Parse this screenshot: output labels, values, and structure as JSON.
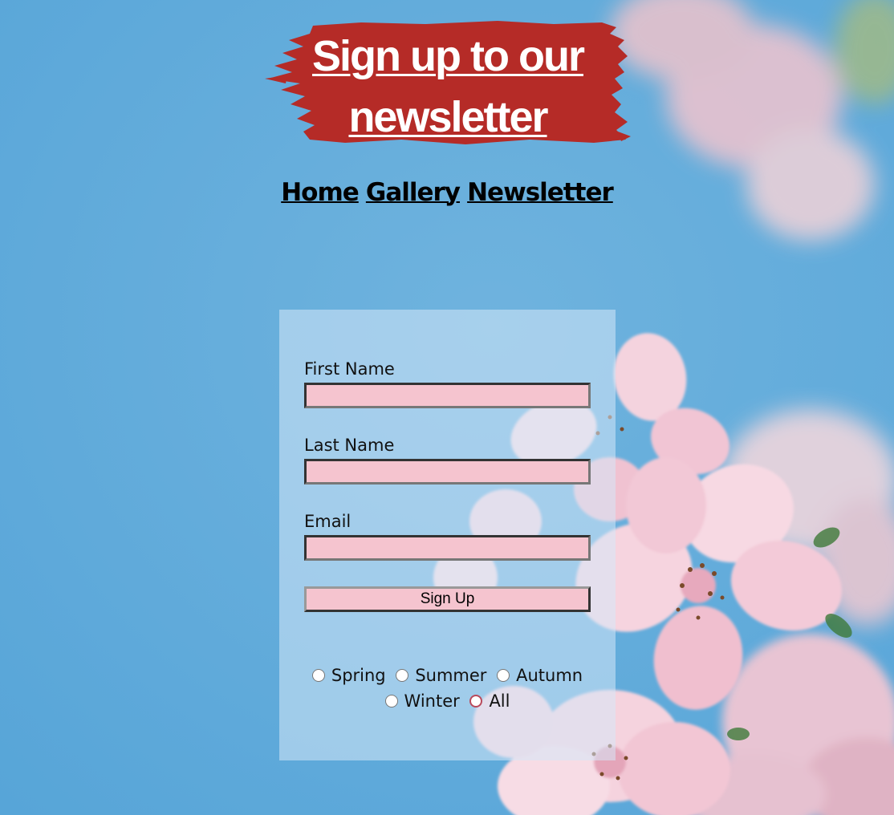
{
  "banner": {
    "title": "Sign up to our newsletter",
    "color": "#b52b27"
  },
  "nav": {
    "links": [
      "Home",
      "Gallery",
      "Newsletter"
    ]
  },
  "form": {
    "first_name_label": "First Name",
    "first_name_value": "",
    "last_name_label": "Last Name",
    "last_name_value": "",
    "email_label": "Email",
    "email_value": "",
    "submit_label": "Sign Up",
    "input_color": "#f5c4cf",
    "season_options": [
      "Spring",
      "Summer",
      "Autumn",
      "Winter",
      "All"
    ],
    "season_selected": "All"
  },
  "background": {
    "sky_color": "#5fa9d9",
    "blossom_color": "#f3c8d6"
  }
}
